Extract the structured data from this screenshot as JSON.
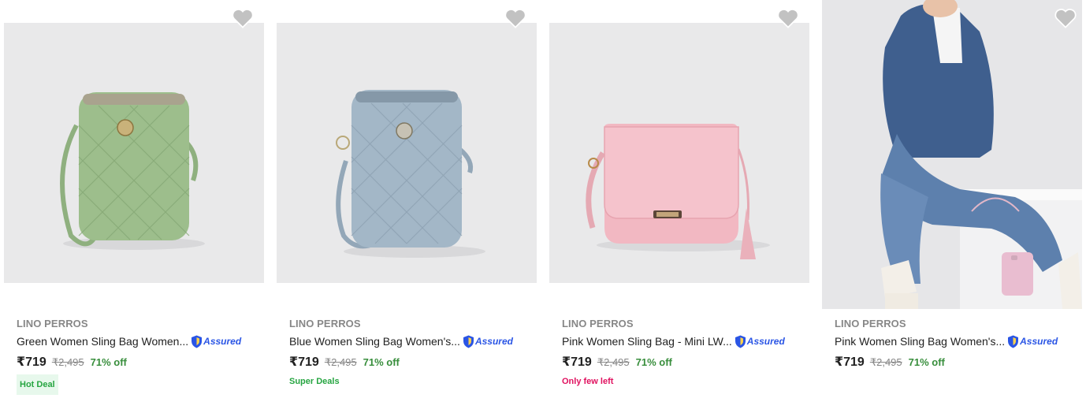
{
  "products": [
    {
      "brand": "LINO PERROS",
      "title": "Green Women Sling Bag Women...",
      "assured": "Assured",
      "price": "₹719",
      "mrp": "₹2,495",
      "discount": "71% off",
      "tag": "Hot Deal",
      "image": "green-quilted-sling-bag"
    },
    {
      "brand": "LINO PERROS",
      "title": "Blue Women Sling Bag Women's...",
      "assured": "Assured",
      "price": "₹719",
      "mrp": "₹2,495",
      "discount": "71% off",
      "tag": "Super Deals",
      "image": "blue-quilted-sling-bag"
    },
    {
      "brand": "LINO PERROS",
      "title": "Pink Women Sling Bag - Mini LW...",
      "assured": "Assured",
      "price": "₹719",
      "mrp": "₹2,495",
      "discount": "71% off",
      "tag": "Only few left",
      "image": "pink-flap-sling-bag-with-tassel"
    },
    {
      "brand": "LINO PERROS",
      "title": "Pink Women Sling Bag Women's...",
      "assured": "Assured",
      "price": "₹719",
      "mrp": "₹2,495",
      "discount": "71% off",
      "tag": "",
      "image": "model-in-denim-with-pink-sling-bag"
    }
  ],
  "colors": {
    "brand_text": "#878787",
    "price_text": "#212121",
    "discount_green": "#388e3c",
    "assured_blue": "#2a55e5",
    "hot_deal_bg": "#e7f8ec",
    "few_left": "#e0115f",
    "wishlist_heart": "#c2c2c2"
  },
  "icons": {
    "wishlist": "heart-icon",
    "assured": "assured-shield-icon"
  }
}
